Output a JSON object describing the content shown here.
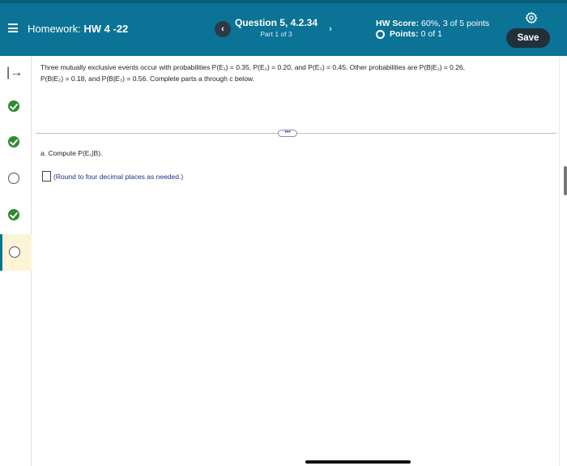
{
  "header": {
    "assignment_prefix": "Homework:",
    "assignment_name": "HW 4 -22",
    "question_title": "Question 5, 4.2.34",
    "question_part": "Part 1 of 3",
    "prev_label": "‹",
    "next_label": "›",
    "score_label": "HW Score:",
    "score_value": "60%, 3 of 5 points",
    "points_label": "Points:",
    "points_value": "0 of 1",
    "save_label": "Save",
    "icons": {
      "menu": "menu-icon",
      "settings": "gear-icon"
    }
  },
  "rail": {
    "collapse_glyph": "|→",
    "items": [
      {
        "status": "complete",
        "icon": "check-circle-icon"
      },
      {
        "status": "complete",
        "icon": "check-circle-icon"
      },
      {
        "status": "incomplete",
        "icon": "empty-circle-icon"
      },
      {
        "status": "complete",
        "icon": "check-circle-icon"
      },
      {
        "status": "incomplete",
        "icon": "empty-circle-icon",
        "current": true
      }
    ]
  },
  "problem": {
    "text_line1": "Three mutually exclusive events occur with probabilities P(E₁) = 0.35, P(E₂) = 0.20, and P(E₃) = 0.45. Other probabilities are P(B|E₁) = 0.26,",
    "text_line2": "P(B|E₂) = 0.18, and P(B|E₃) = 0.56. Complete parts a through c below."
  },
  "expand_label": "•••",
  "part_a": {
    "prompt": "a. Compute P(E₁|B).",
    "hint": "(Round to four decimal places as needed.)",
    "answer_value": ""
  },
  "colors": {
    "header_bg": "#0b7395",
    "save_bg": "#22303a",
    "complete_green": "#2e8b2e",
    "active_row_bg": "#fdf3d6",
    "hint_blue": "#1e2f88"
  }
}
